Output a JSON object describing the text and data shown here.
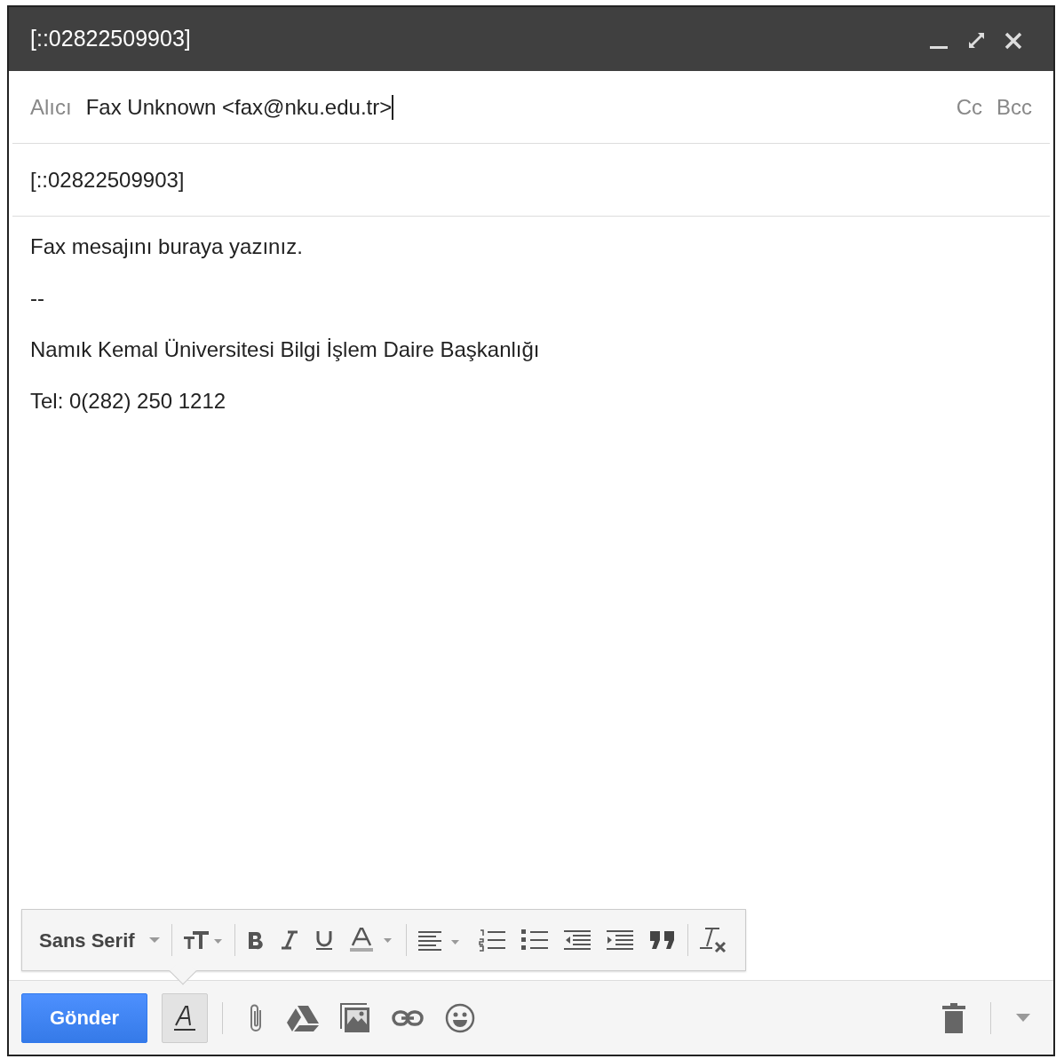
{
  "window": {
    "title": "[::02822509903]",
    "controls": [
      {
        "kind": "minimize"
      },
      {
        "kind": "expand"
      },
      {
        "kind": "close"
      }
    ]
  },
  "recipients": {
    "label": "Alıcı",
    "value": "Fax Unknown <fax@nku.edu.tr>",
    "cc": "Cc",
    "bcc": "Bcc"
  },
  "subject": {
    "value": "[::02822509903]"
  },
  "body": [
    {
      "text": "Fax mesajını buraya yazınız."
    },
    {
      "text": "--"
    },
    {
      "text": "Namık Kemal Üniversitesi Bilgi İşlem Daire Başkanlığı"
    },
    {
      "text": "Tel: 0(282) 250 1212"
    }
  ],
  "format_toolbar": [
    {
      "kind": "font",
      "label": "Sans Serif"
    },
    {
      "kind": "separator"
    },
    {
      "kind": "size"
    },
    {
      "kind": "separator"
    },
    {
      "kind": "bold"
    },
    {
      "kind": "italic"
    },
    {
      "kind": "underline"
    },
    {
      "kind": "color"
    },
    {
      "kind": "separator"
    },
    {
      "kind": "align"
    },
    {
      "kind": "numbered"
    },
    {
      "kind": "bulleted"
    },
    {
      "kind": "outdent"
    },
    {
      "kind": "indent"
    },
    {
      "kind": "quote"
    },
    {
      "kind": "separator"
    },
    {
      "kind": "clear"
    }
  ],
  "bottom_bar": {
    "send": "Gönder",
    "formatting_pressed": true,
    "tools": [
      {
        "kind": "attach"
      },
      {
        "kind": "drive"
      },
      {
        "kind": "photo"
      },
      {
        "kind": "link"
      },
      {
        "kind": "emoji"
      }
    ]
  }
}
